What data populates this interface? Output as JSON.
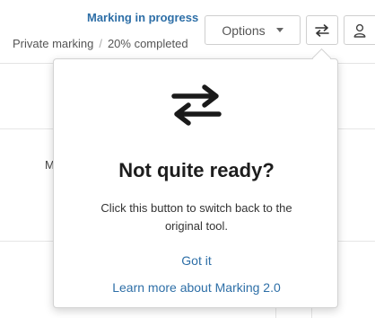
{
  "header": {
    "status_title": "Marking in progress",
    "status_mode": "Private marking",
    "status_separator": "/",
    "status_progress": "20% completed"
  },
  "toolbar": {
    "options_label": "Options",
    "icons": {
      "switch": "switch-arrows-icon",
      "user": "user-icon",
      "options": "caret-down-icon"
    }
  },
  "background": {
    "clipped_column_letter": "M"
  },
  "popover": {
    "icon": "switch-arrows-icon",
    "title": "Not quite ready?",
    "text": "Click this button to switch back to the original tool.",
    "got_it_label": "Got it",
    "learn_more_label": "Learn more about Marking 2.0"
  },
  "colors": {
    "link": "#2e6fa7",
    "title": "#1d1d1d",
    "border": "#cfcfcf"
  }
}
